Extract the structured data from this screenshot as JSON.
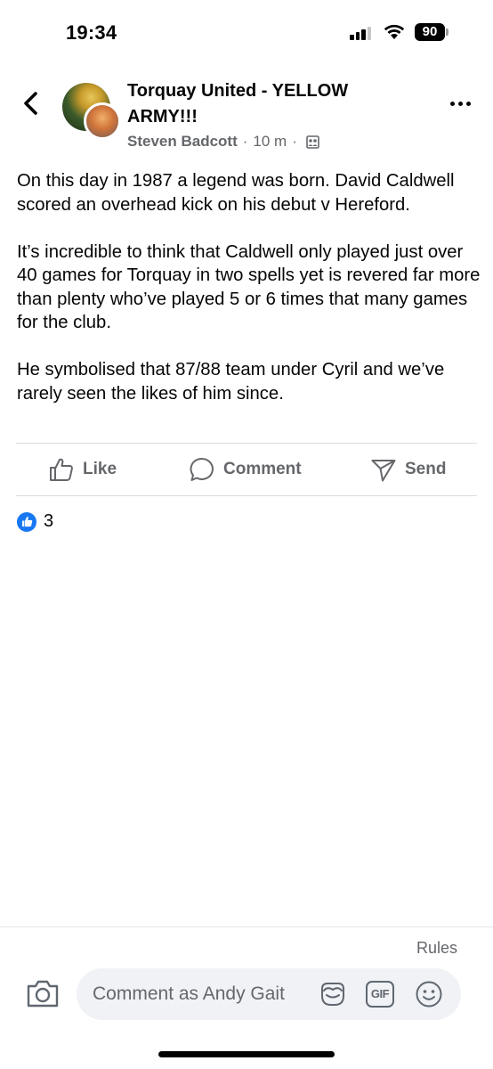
{
  "status": {
    "time": "19:34",
    "battery": "90"
  },
  "header": {
    "group_name": "Torquay United - YELLOW ARMY!!!",
    "author": "Steven Badcott",
    "time_ago": "10 m",
    "separator": "·"
  },
  "post": {
    "paragraphs": [
      "On this day in 1987 a legend was born. David Caldwell scored an overhead kick on his debut v Hereford.",
      "It’s incredible to think that Caldwell only played just over 40 games for Torquay in two spells yet is revered far more than plenty who’ve played 5 or 6 times that many games for the club.",
      "He symbolised that 87/88 team under Cyril and we’ve rarely seen the likes of him since."
    ]
  },
  "actions": {
    "like": "Like",
    "comment": "Comment",
    "send": "Send"
  },
  "reactions": {
    "count": "3"
  },
  "composer": {
    "rules": "Rules",
    "placeholder": "Comment as Andy Gait",
    "gif": "GIF"
  },
  "colors": {
    "accent": "#1877f2",
    "secondary_text": "#65676b",
    "input_bg": "#f0f2f5"
  }
}
